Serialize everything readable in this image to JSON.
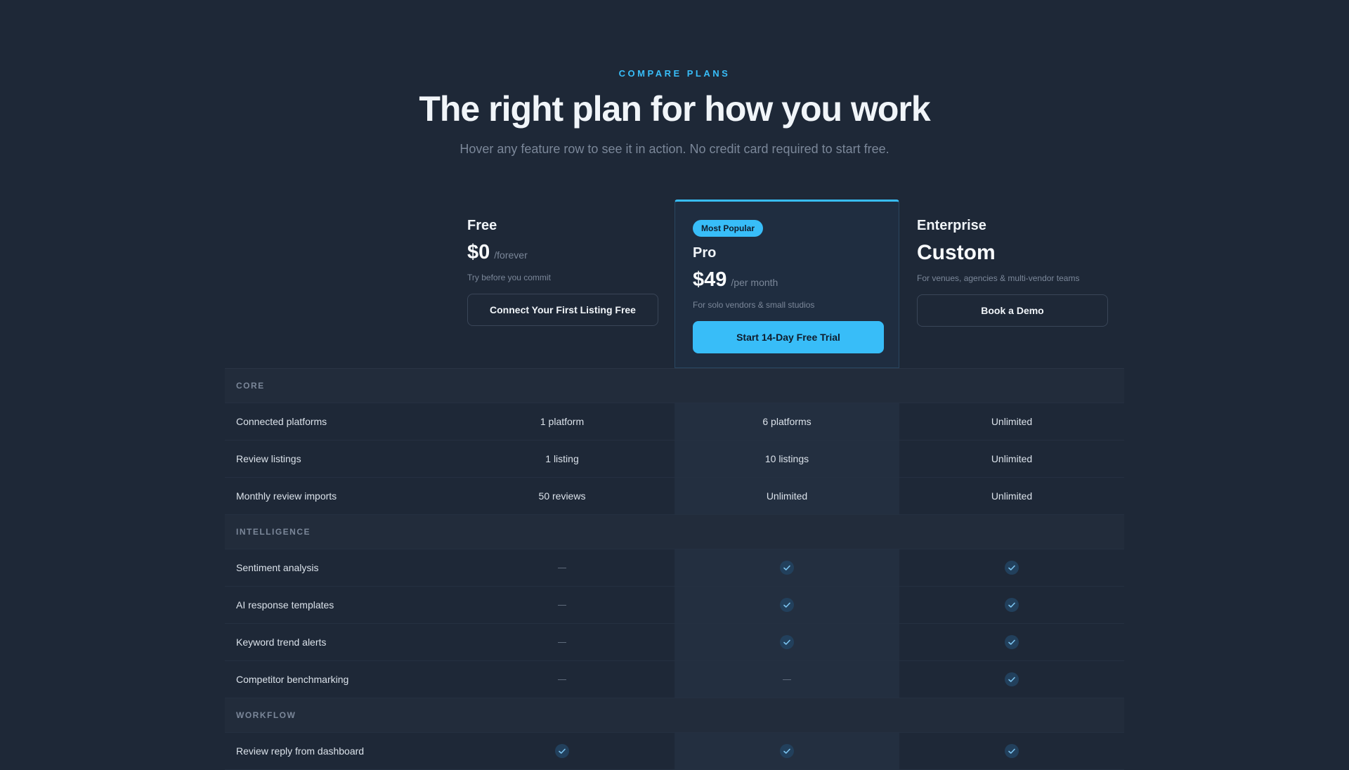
{
  "hero": {
    "eyebrow": "COMPARE PLANS",
    "title": "The right plan for how you work",
    "subtitle": "Hover any feature row to see it in action. No credit card required to start free."
  },
  "plans": {
    "free": {
      "name": "Free",
      "price": "$0",
      "period": "/forever",
      "desc": "Try before you commit",
      "cta": "Connect Your First Listing Free"
    },
    "pro": {
      "badge": "Most Popular",
      "name": "Pro",
      "price": "$49",
      "period": "/per month",
      "desc": "For solo vendors & small studios",
      "cta": "Start 14-Day Free Trial"
    },
    "enterprise": {
      "name": "Enterprise",
      "price": "Custom",
      "desc": "For venues, agencies & multi-vendor teams",
      "cta": "Book a Demo"
    }
  },
  "table": {
    "sections": [
      {
        "title": "CORE",
        "rows": [
          {
            "feature": "Connected platforms",
            "free": "1 platform",
            "pro": "6 platforms",
            "enterprise": "Unlimited"
          },
          {
            "feature": "Review listings",
            "free": "1 listing",
            "pro": "10 listings",
            "enterprise": "Unlimited"
          },
          {
            "feature": "Monthly review imports",
            "free": "50 reviews",
            "pro": "Unlimited",
            "enterprise": "Unlimited"
          }
        ]
      },
      {
        "title": "INTELLIGENCE",
        "rows": [
          {
            "feature": "Sentiment analysis",
            "free": "dash",
            "pro": "check",
            "enterprise": "check"
          },
          {
            "feature": "AI response templates",
            "free": "dash",
            "pro": "check",
            "enterprise": "check"
          },
          {
            "feature": "Keyword trend alerts",
            "free": "dash",
            "pro": "check",
            "enterprise": "check"
          },
          {
            "feature": "Competitor benchmarking",
            "free": "dash",
            "pro": "dash",
            "enterprise": "check"
          }
        ]
      },
      {
        "title": "WORKFLOW",
        "rows": [
          {
            "feature": "Review reply from dashboard",
            "free": "check",
            "pro": "check",
            "enterprise": "check"
          }
        ]
      }
    ]
  },
  "colors": {
    "accent": "#38bdf8",
    "background": "#1e2837",
    "check_bg": "#22405c"
  },
  "icons": {
    "check": "check-icon",
    "dash": "dash-icon"
  }
}
